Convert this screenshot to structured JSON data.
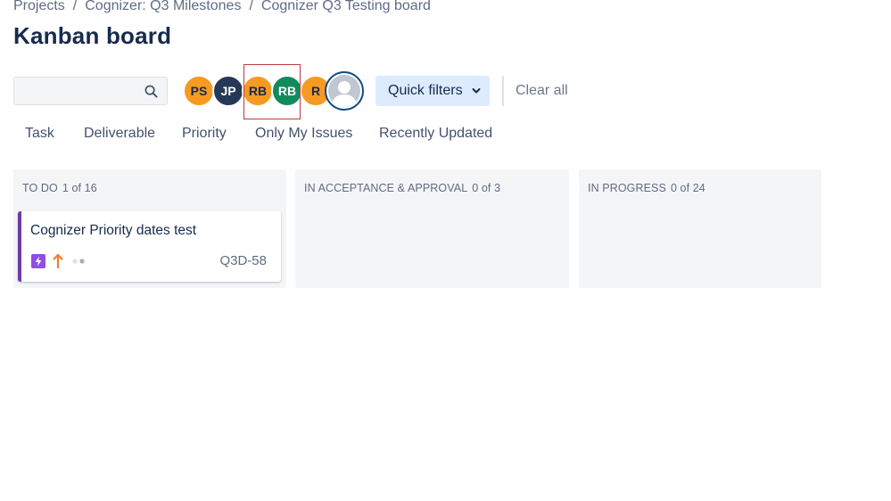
{
  "breadcrumb": {
    "items": [
      "Projects",
      "Cognizer: Q3 Milestones",
      "Cognizer Q3 Testing board"
    ],
    "separator": "/"
  },
  "page": {
    "title": "Kanban board"
  },
  "search": {
    "value": "",
    "placeholder": "",
    "icon": "search-icon"
  },
  "avatars": [
    {
      "initials": "PS",
      "color": "#f79a21"
    },
    {
      "initials": "JP",
      "color": "#253858"
    },
    {
      "initials": "RB",
      "color": "#f79a21"
    },
    {
      "initials": "RB",
      "color": "#138a5e"
    },
    {
      "initials": "R",
      "color": "#f79a21"
    },
    {
      "initials": "",
      "icon": "default-user-avatar-icon"
    }
  ],
  "toolbar": {
    "quick_filters_label": "Quick filters",
    "clear_all_label": "Clear all"
  },
  "filters": [
    "Task",
    "Deliverable",
    "Priority",
    "Only My Issues",
    "Recently Updated"
  ],
  "columns": [
    {
      "name": "TO DO",
      "count": "1 of 16"
    },
    {
      "name": "IN ACCEPTANCE & APPROVAL",
      "count": "0 of 3"
    },
    {
      "name": "IN PROGRESS",
      "count": "0 of 24"
    }
  ],
  "cards": [
    {
      "title": "Cognizer Priority dates test",
      "key": "Q3D-58",
      "type_icon": "lightning-icon",
      "priority_icon": "arrow-up-icon",
      "estimate_icon": "dots-icon",
      "accent_color": "#6e3aa8"
    }
  ],
  "colors": {
    "title": "#172b4d",
    "muted": "#5e6c84",
    "quick_filters_bg": "#deebff",
    "column_bg": "#f4f5f7",
    "highlight": "#c0393b",
    "priority": "#e97f33"
  }
}
